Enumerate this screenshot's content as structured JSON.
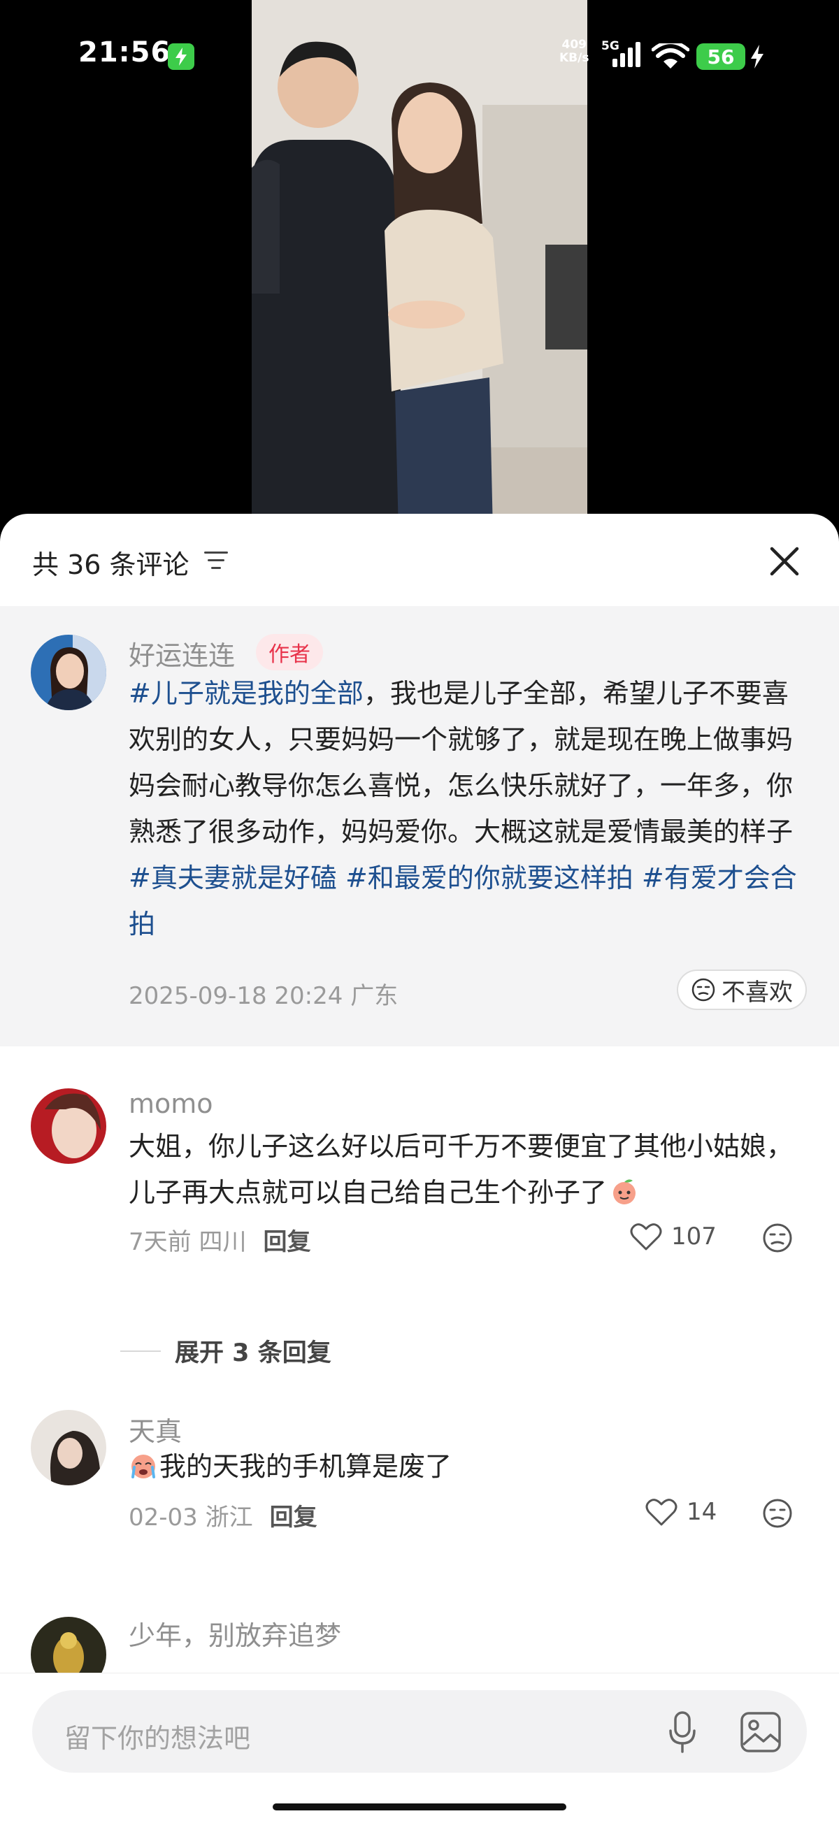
{
  "status_bar": {
    "time": "21:56",
    "net_speed_value": "409",
    "net_speed_unit": "KB/s",
    "net_type": "5G",
    "battery": "56",
    "icons": [
      "charging-icon",
      "signal-icon",
      "wifi-icon",
      "battery-icon",
      "bolt-icon"
    ]
  },
  "sheet": {
    "count_label": "共 36 条评论",
    "sort_icon": "sort-icon",
    "close_icon": "close-icon"
  },
  "author_comment": {
    "name": "好运连连",
    "badge": "作者",
    "segments": [
      {
        "text": "#儿子就是我的全部",
        "tag": true
      },
      {
        "text": "，我也是儿子全部，希望儿子不要喜欢别的女人，只要妈妈一个就够了，就是现在晚上做事妈妈会耐心教导你怎么喜悦，怎么快乐就好了，一年多，你熟悉了很多动作，妈妈爱你。大概这就是爱情最美的样子 ",
        "tag": false
      },
      {
        "text": "#真夫妻就是好磕",
        "tag": true
      },
      {
        "text": " ",
        "tag": false
      },
      {
        "text": "#和最爱的你就要这样拍",
        "tag": true
      },
      {
        "text": " ",
        "tag": false
      },
      {
        "text": "#有爱才会合拍",
        "tag": true
      }
    ],
    "meta": "2025-09-18 20:24 广东",
    "dislike_label": "不喜欢"
  },
  "comments": [
    {
      "name": "momo",
      "text": "大姐，你儿子这么好以后可千万不要便宜了其他小姑娘，儿子再大点就可以自己给自己生个孙子了",
      "emoji": "peach-emoji",
      "meta": "7天前 四川",
      "reply_label": "回复",
      "likes": "107"
    },
    {
      "name": "天真",
      "text": "我的天我的手机算是废了",
      "emoji": "crying-emoji",
      "meta": "02-03 浙江",
      "reply_label": "回复",
      "likes": "14"
    },
    {
      "name": "少年，别放弃追梦"
    }
  ],
  "expand_replies": "展开 3 条回复",
  "input": {
    "placeholder": "留下你的想法吧",
    "mic_icon": "mic-icon",
    "image_icon": "image-icon"
  },
  "colors": {
    "tag": "#1d4f8f",
    "author_badge_bg": "#fde8ea",
    "author_badge_text": "#e8324a",
    "battery_green": "#3dcc4a",
    "author_block_bg": "#f4f4f5"
  }
}
